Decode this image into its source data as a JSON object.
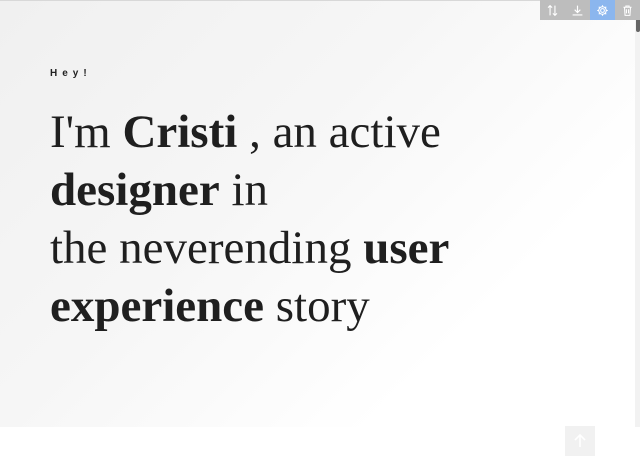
{
  "hero": {
    "greeting": "Hey!",
    "headline": {
      "part1": "I'm ",
      "name": "Cristi",
      "part2": " , an active ",
      "role": "designer",
      "part3": " in",
      "part4": "the neverending ",
      "emph1": "user",
      "emph2": "experience",
      "part5": " story"
    }
  },
  "toolbar": {
    "tools": [
      {
        "icon": "sort-icon",
        "active": false
      },
      {
        "icon": "download-icon",
        "active": false
      },
      {
        "icon": "gear-icon",
        "active": true
      },
      {
        "icon": "trash-icon",
        "active": false
      }
    ]
  },
  "back_to_top": {
    "icon": "arrow-up-icon"
  },
  "colors": {
    "text": "#1f1f1f",
    "tool_bg": "#bdbdbd",
    "tool_active_bg": "#8bb6ee"
  }
}
